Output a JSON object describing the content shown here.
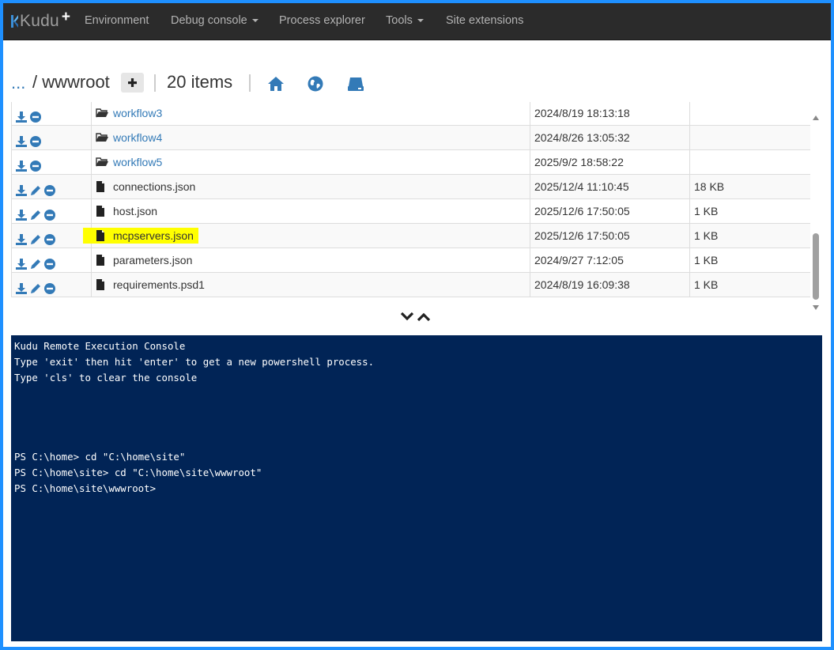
{
  "navbar": {
    "brand": "Kudu",
    "brand_plus": "+",
    "items": [
      {
        "label": "Environment",
        "dropdown": false
      },
      {
        "label": "Debug console",
        "dropdown": true
      },
      {
        "label": "Process explorer",
        "dropdown": false
      },
      {
        "label": "Tools",
        "dropdown": true
      },
      {
        "label": "Site extensions",
        "dropdown": false
      }
    ]
  },
  "header": {
    "breadcrumb_root": "...",
    "breadcrumb_path": "/ wwwroot",
    "item_count": "20 items",
    "icons": [
      "home-icon",
      "globe-icon",
      "drive-icon"
    ]
  },
  "files": [
    {
      "name": "workflow3",
      "type": "folder",
      "modified": "2024/8/19 18:13:18",
      "size": ""
    },
    {
      "name": "workflow4",
      "type": "folder",
      "modified": "2024/8/26 13:05:32",
      "size": ""
    },
    {
      "name": "workflow5",
      "type": "folder",
      "modified": "2025/9/2 18:58:22",
      "size": ""
    },
    {
      "name": "connections.json",
      "type": "file",
      "modified": "2025/12/4 11:10:45",
      "size": "18 KB"
    },
    {
      "name": "host.json",
      "type": "file",
      "modified": "2025/12/6 17:50:05",
      "size": "1 KB"
    },
    {
      "name": "mcpservers.json",
      "type": "file",
      "modified": "2025/12/6 17:50:05",
      "size": "1 KB",
      "highlighted": true
    },
    {
      "name": "parameters.json",
      "type": "file",
      "modified": "2024/9/27 7:12:05",
      "size": "1 KB"
    },
    {
      "name": "requirements.psd1",
      "type": "file",
      "modified": "2024/8/19 16:09:38",
      "size": "1 KB"
    }
  ],
  "console": {
    "lines": [
      "Kudu Remote Execution Console",
      "Type 'exit' then hit 'enter' to get a new powershell process.",
      "Type 'cls' to clear the console",
      "",
      "",
      "",
      "",
      "PS C:\\home> cd \"C:\\home\\site\"",
      "PS C:\\home\\site> cd \"C:\\home\\site\\wwwroot\"",
      "PS C:\\home\\site\\wwwroot>"
    ]
  },
  "colors": {
    "navbar_bg": "#2b2b2b",
    "link": "#337ab7",
    "icon_blue": "#337ab7",
    "console_bg": "#012456",
    "highlight": "#ffff00",
    "frame": "#1e90ff"
  }
}
